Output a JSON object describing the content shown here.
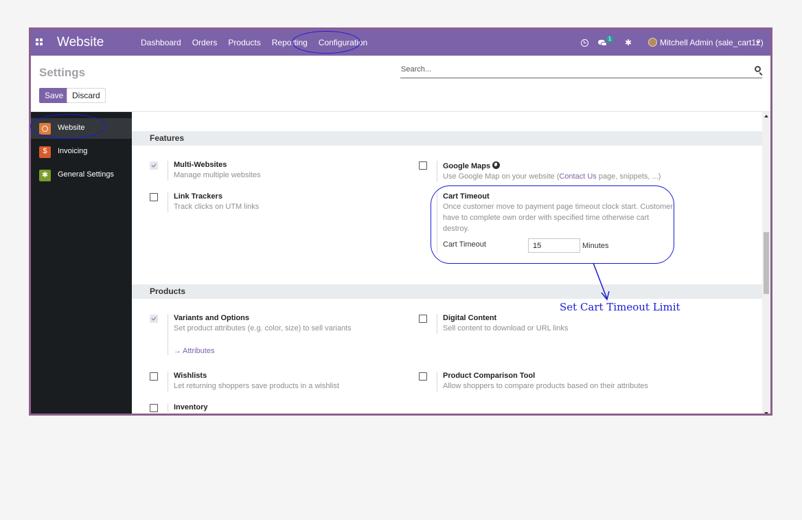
{
  "navbar": {
    "brand": "Website",
    "menu": [
      "Dashboard",
      "Orders",
      "Products",
      "Reporting",
      "Configuration"
    ],
    "message_count": "1",
    "user": "Mitchell Admin (sale_cart12)"
  },
  "control_panel": {
    "title": "Settings",
    "search_placeholder": "Search...",
    "save_label": "Save",
    "discard_label": "Discard"
  },
  "sidebar": {
    "items": [
      {
        "label": "Website",
        "icon": "globe-icon",
        "active": true
      },
      {
        "label": "Invoicing",
        "icon": "invoice-icon",
        "active": false
      },
      {
        "label": "General Settings",
        "icon": "settings-icon",
        "active": false
      }
    ]
  },
  "features": {
    "header": "Features",
    "multi_websites": {
      "title": "Multi-Websites",
      "desc": "Manage multiple websites",
      "checked": true
    },
    "google_maps": {
      "title": "Google Maps",
      "desc_before": "Use Google Map on your website (",
      "link": "Contact Us",
      "desc_after": " page, snippets, ...)",
      "checked": false
    },
    "link_trackers": {
      "title": "Link Trackers",
      "desc": "Track clicks on UTM links",
      "checked": false
    },
    "cart_timeout": {
      "title": "Cart Timeout",
      "desc": "Once customer move to payment page timeout clock start. Customer have to complete own order with specified time otherwise cart destroy.",
      "field_label": "Cart Timeout",
      "value": "15",
      "unit": "Minutes"
    }
  },
  "products": {
    "header": "Products",
    "variants": {
      "title": "Variants and Options",
      "desc": "Set product attributes (e.g. color, size) to sell variants",
      "link": "Attributes",
      "checked": true
    },
    "digital_content": {
      "title": "Digital Content",
      "desc": "Sell content to download or URL links",
      "checked": false
    },
    "wishlists": {
      "title": "Wishlists",
      "desc": "Let returning shoppers save products in a wishlist",
      "checked": false
    },
    "comparison": {
      "title": "Product Comparison Tool",
      "desc": "Allow shoppers to compare products based on their attributes",
      "checked": false
    },
    "inventory": {
      "title": "Inventory",
      "checked": false
    }
  },
  "annotation": {
    "text": "Set Cart Timeout Limit",
    "color": "#1a1ad4"
  },
  "colors": {
    "primary": "#7c62a9",
    "sidebar_bg": "#1a1d20",
    "frame": "#8d5f8d"
  }
}
